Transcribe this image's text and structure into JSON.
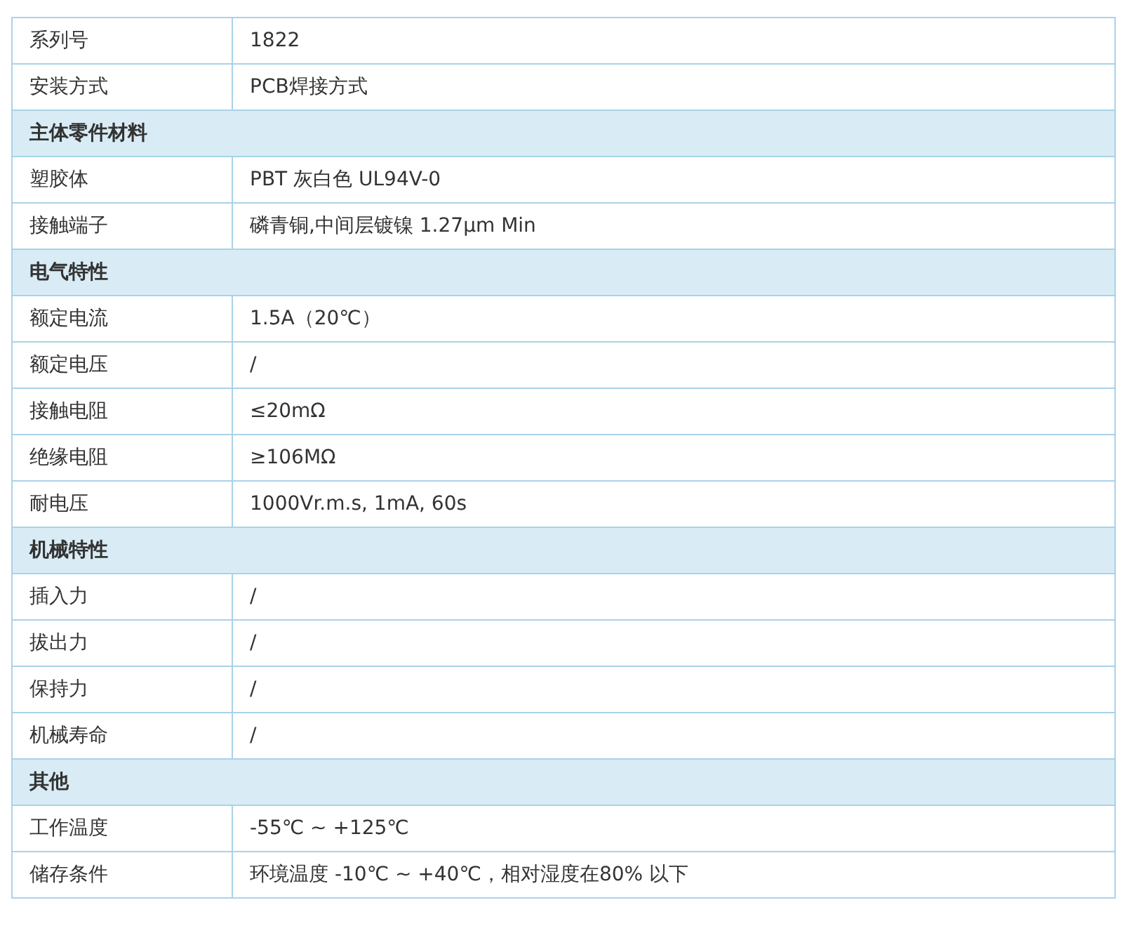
{
  "table": {
    "rows": [
      {
        "kind": "row",
        "label": "系列号",
        "value": "1822"
      },
      {
        "kind": "row",
        "label": "安装方式",
        "value": "PCB焊接方式"
      },
      {
        "kind": "section",
        "label": "主体零件材料"
      },
      {
        "kind": "row",
        "label": "塑胶体",
        "value": "PBT 灰白色 UL94V-0"
      },
      {
        "kind": "row",
        "label": "接触端子",
        "value": "磷青铜,中间层镀镍 1.27μm Min"
      },
      {
        "kind": "section",
        "label": "电气特性"
      },
      {
        "kind": "row",
        "label": "额定电流",
        "value": "1.5A（20℃）"
      },
      {
        "kind": "row",
        "label": "额定电压",
        "value": "/"
      },
      {
        "kind": "row",
        "label": "接触电阻",
        "value": "≤20mΩ"
      },
      {
        "kind": "row",
        "label": "绝缘电阻",
        "value": "≥106MΩ"
      },
      {
        "kind": "row",
        "label": "耐电压",
        "value": "1000Vr.m.s, 1mA, 60s"
      },
      {
        "kind": "section",
        "label": "机械特性"
      },
      {
        "kind": "row",
        "label": "插入力",
        "value": "/"
      },
      {
        "kind": "row",
        "label": "拔出力",
        "value": "/"
      },
      {
        "kind": "row",
        "label": "保持力",
        "value": "/"
      },
      {
        "kind": "row",
        "label": "机械寿命",
        "value": "/"
      },
      {
        "kind": "section",
        "label": "其他"
      },
      {
        "kind": "row",
        "label": "工作温度",
        "value": "-55℃ ~ +125℃"
      },
      {
        "kind": "row",
        "label": "储存条件",
        "value": "环境温度 -10℃ ~ +40℃，相对湿度在80% 以下"
      }
    ]
  }
}
